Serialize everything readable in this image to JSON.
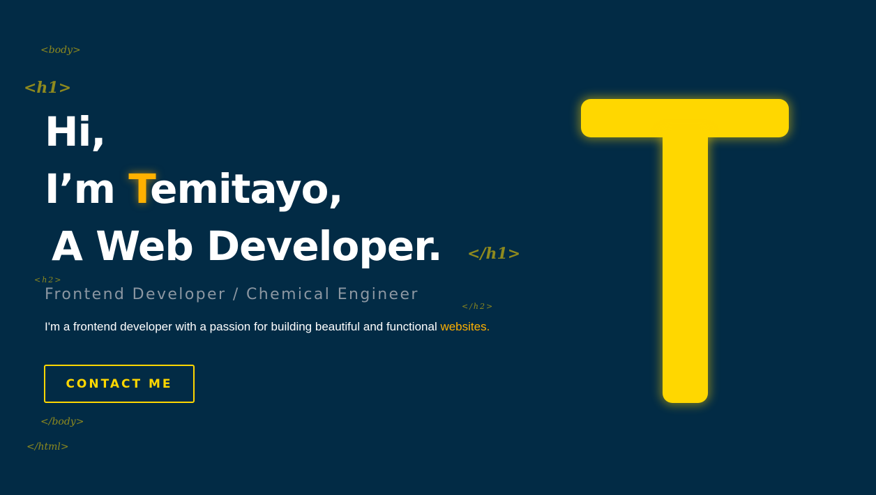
{
  "decor_tags": {
    "body_open": "<body>",
    "h1_open": "<h1>",
    "h1_close": "</h1>",
    "h2_open": "<h2>",
    "h2_close": "</h2>",
    "body_close": "</body>",
    "html_close": "</html>"
  },
  "hero": {
    "line1": "Hi,",
    "line2_prefix": "I’m ",
    "line2_accent": "T",
    "line2_rest": "emitayo,",
    "line3": "A Web Developer."
  },
  "subtitle": "Frontend Developer / Chemical Engineer",
  "intro": {
    "text": "I'm a frontend developer with a passion for building beautiful and functional ",
    "highlight": "websites."
  },
  "contact_button": {
    "label": "CONTACT ME"
  },
  "logo": {
    "letter": "T",
    "icon": "letter-t-logo"
  },
  "colors": {
    "background": "#022b45",
    "accent": "#ffb100",
    "logo_yellow": "#ffd700",
    "tag_olive": "#8f8a1e",
    "subtitle_gray": "#8c97a2"
  }
}
